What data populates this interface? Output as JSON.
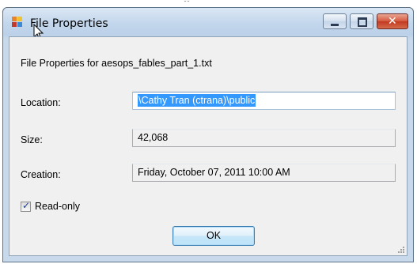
{
  "window": {
    "title": "File Properties",
    "caption_buttons": {
      "minimize": "minimize-icon",
      "maximize": "maximize-icon",
      "close": "close-icon"
    }
  },
  "heading": "File Properties for aesops_fables_part_1.txt",
  "fields": {
    "location": {
      "label": "Location:",
      "value": "\\Cathy Tran (ctrana)\\public"
    },
    "size": {
      "label": "Size:",
      "value": "42,068"
    },
    "creation": {
      "label": "Creation:",
      "value": "Friday, October 07, 2011 10:00 AM"
    }
  },
  "readonly": {
    "label": "Read-only",
    "checked": true
  },
  "ok_label": "OK",
  "colors": {
    "titlebar": "#c2d6ec",
    "selection": "#3399ff",
    "client": "#f0f0f0",
    "close": "#c13a22"
  }
}
